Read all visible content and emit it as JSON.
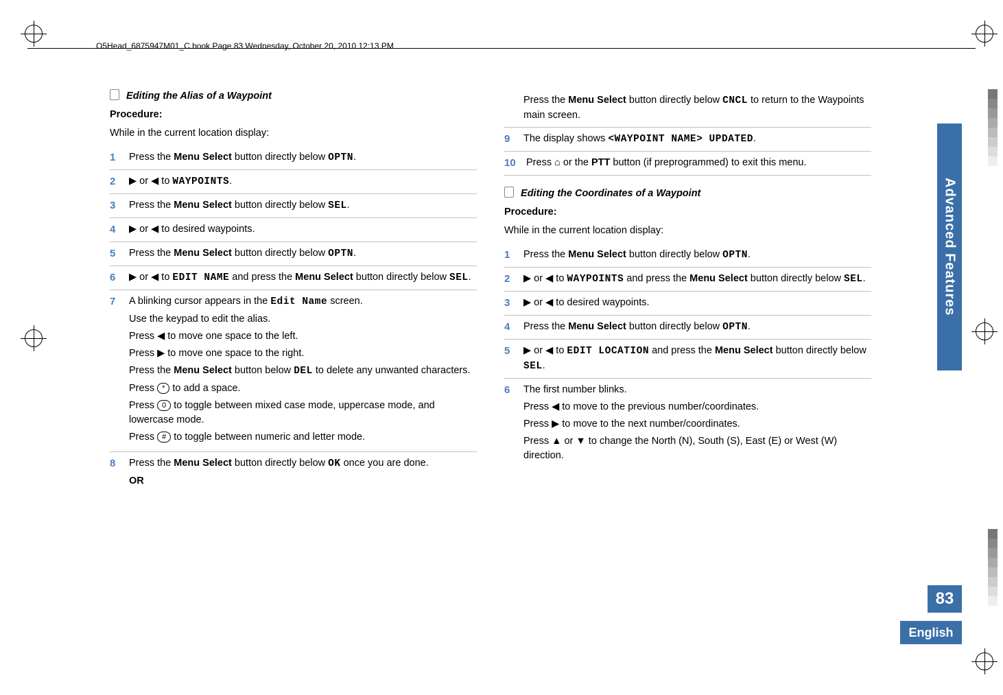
{
  "header": "O5Head_6875947M01_C.book  Page 83  Wednesday, October 20, 2010  12:13 PM",
  "side_tab": "Advanced Features",
  "page_number": "83",
  "language": "English",
  "left": {
    "section_title": "Editing the Alias of a Waypoint",
    "procedure_label": "Procedure:",
    "intro": "While in the current location display:",
    "steps": {
      "s1": {
        "num": "1",
        "a": "Press the ",
        "b": "Menu Select",
        "c": " button directly below ",
        "d": "OPTN",
        "e": "."
      },
      "s2": {
        "num": "2",
        "pre": " or ",
        "mid": " to ",
        "wp": "WAYPOINTS",
        "end": "."
      },
      "s3": {
        "num": "3",
        "a": "Press the ",
        "b": "Menu Select",
        "c": " button directly below ",
        "d": "SEL",
        "e": "."
      },
      "s4": {
        "num": "4",
        "pre": " or ",
        "end": " to desired waypoints."
      },
      "s5": {
        "num": "5",
        "a": "Press the ",
        "b": "Menu Select",
        "c": " button directly below ",
        "d": "OPTN",
        "e": "."
      },
      "s6": {
        "num": "6",
        "pre": " or ",
        "mid": " to ",
        "tgt": "EDIT NAME",
        "a": " and press the ",
        "b": "Menu Select",
        "c": " button directly below ",
        "d": "SEL",
        "e": "."
      },
      "s7": {
        "num": "7",
        "l1a": "A blinking cursor appears in the ",
        "l1b": "Edit Name",
        "l1c": " screen.",
        "l2": "Use the keypad to edit the alias.",
        "l3a": "Press ",
        "l3b": " to move one space to the left.",
        "l4a": "Press ",
        "l4b": " to move one space to the right.",
        "l5a": "Press the ",
        "l5b": "Menu Select",
        "l5c": " button below ",
        "l5d": "DEL",
        "l5e": " to delete any unwanted characters.",
        "l6a": "Press ",
        "l6key": "*",
        "l6b": " to add a space.",
        "l7a": "Press ",
        "l7key": "0",
        "l7b": " to toggle between mixed case mode, uppercase mode, and lowercase mode.",
        "l8a": "Press ",
        "l8key": "#",
        "l8b": " to toggle between numeric and letter mode."
      },
      "s8": {
        "num": "8",
        "a": "Press the ",
        "b": "Menu Select",
        "c": " button directly below ",
        "d": "OK",
        "e": " once you are done.",
        "or": "OR"
      }
    }
  },
  "right": {
    "cont": {
      "a": "Press the ",
      "b": "Menu Select",
      "c": " button directly below ",
      "d": "CNCL",
      "e": " to return to the Waypoints main screen."
    },
    "s9": {
      "num": "9",
      "a": "The display shows ",
      "b": "<WAYPOINT NAME> UPDATED",
      "c": "."
    },
    "s10": {
      "num": "10",
      "a": "Press ",
      "home": "⌂",
      "b": " or the ",
      "c": "PTT",
      "d": " button (if preprogrammed) to exit this menu."
    },
    "section_title": "Editing the Coordinates of a Waypoint",
    "procedure_label": "Procedure:",
    "intro": "While in the current location display:",
    "steps": {
      "s1": {
        "num": "1",
        "a": "Press the ",
        "b": "Menu Select",
        "c": " button directly below ",
        "d": "OPTN",
        "e": "."
      },
      "s2": {
        "num": "2",
        "pre": " or ",
        "mid": " to ",
        "wp": "WAYPOINTS",
        "a": " and press the ",
        "b": "Menu Select",
        "c": " button directly below ",
        "d": "SEL",
        "e": "."
      },
      "s3": {
        "num": "3",
        "pre": " or ",
        "end": " to desired waypoints."
      },
      "s4": {
        "num": "4",
        "a": "Press the ",
        "b": "Menu Select",
        "c": " button directly below ",
        "d": "OPTN",
        "e": "."
      },
      "s5": {
        "num": "5",
        "pre": " or ",
        "mid": " to ",
        "tgt": "EDIT LOCATION",
        "a": " and press the ",
        "b": "Menu Select",
        "c": " button directly below ",
        "d": "SEL",
        "e": "."
      },
      "s6": {
        "num": "6",
        "l1": "The first number blinks.",
        "l2a": "Press ",
        "l2b": " to move to the previous number/coordinates.",
        "l3a": "Press ",
        "l3b": " to move to the next number/coordinates.",
        "l4a": "Press ",
        "l4b": " or ",
        "l4c": " to change the North (N), South (S), East (E) or West (W) direction."
      }
    }
  }
}
